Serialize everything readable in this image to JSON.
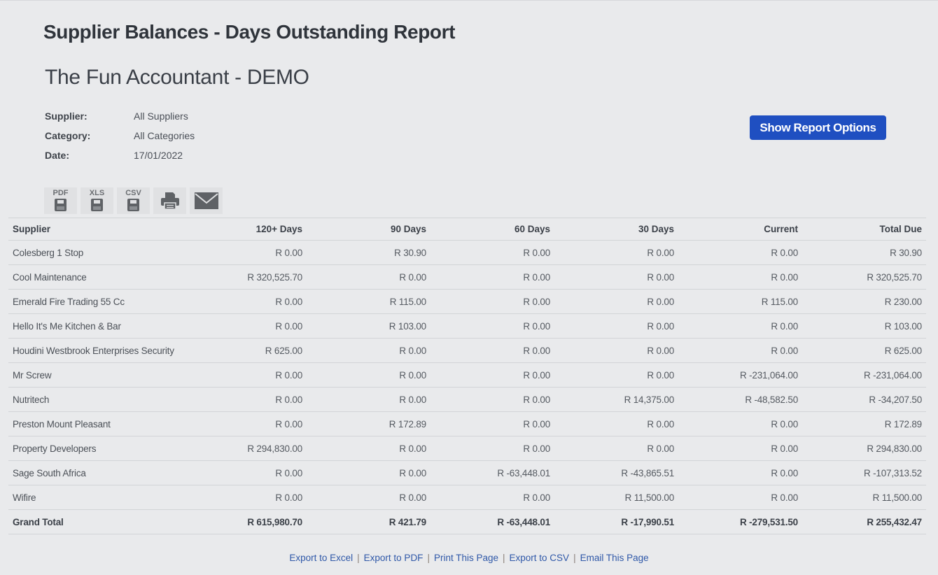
{
  "header": {
    "report_title": "Supplier Balances - Days Outstanding Report",
    "company_name": "The Fun Accountant - DEMO"
  },
  "filters": [
    {
      "label": "Supplier:",
      "value": "All Suppliers"
    },
    {
      "label": "Category:",
      "value": "All Categories"
    },
    {
      "label": "Date:",
      "value": "17/01/2022"
    }
  ],
  "options_button": {
    "label": "Show Report Options",
    "color": "#1f4fc1"
  },
  "export_icons": [
    {
      "name": "pdf-export",
      "label": "PDF",
      "icon": "floppy-disk-icon"
    },
    {
      "name": "xls-export",
      "label": "XLS",
      "icon": "floppy-disk-icon"
    },
    {
      "name": "csv-export",
      "label": "CSV",
      "icon": "floppy-disk-icon"
    },
    {
      "name": "print",
      "label": "",
      "icon": "printer-icon"
    },
    {
      "name": "email",
      "label": "",
      "icon": "envelope-icon"
    }
  ],
  "table": {
    "columns": [
      "Supplier",
      "120+ Days",
      "90 Days",
      "60 Days",
      "30 Days",
      "Current",
      "Total Due"
    ],
    "rows": [
      [
        "Colesberg 1 Stop",
        "R 0.00",
        "R 30.90",
        "R 0.00",
        "R 0.00",
        "R 0.00",
        "R 30.90"
      ],
      [
        "Cool Maintenance",
        "R 320,525.70",
        "R 0.00",
        "R 0.00",
        "R 0.00",
        "R 0.00",
        "R 320,525.70"
      ],
      [
        "Emerald Fire Trading 55 Cc",
        "R 0.00",
        "R 115.00",
        "R 0.00",
        "R 0.00",
        "R 115.00",
        "R 230.00"
      ],
      [
        "Hello It's Me Kitchen & Bar",
        "R 0.00",
        "R 103.00",
        "R 0.00",
        "R 0.00",
        "R 0.00",
        "R 103.00"
      ],
      [
        "Houdini Westbrook Enterprises Security",
        "R 625.00",
        "R 0.00",
        "R 0.00",
        "R 0.00",
        "R 0.00",
        "R 625.00"
      ],
      [
        "Mr Screw",
        "R 0.00",
        "R 0.00",
        "R 0.00",
        "R 0.00",
        "R -231,064.00",
        "R -231,064.00"
      ],
      [
        "Nutritech",
        "R 0.00",
        "R 0.00",
        "R 0.00",
        "R 14,375.00",
        "R -48,582.50",
        "R -34,207.50"
      ],
      [
        "Preston Mount Pleasant",
        "R 0.00",
        "R 172.89",
        "R 0.00",
        "R 0.00",
        "R 0.00",
        "R 172.89"
      ],
      [
        "Property Developers",
        "R 294,830.00",
        "R 0.00",
        "R 0.00",
        "R 0.00",
        "R 0.00",
        "R 294,830.00"
      ],
      [
        "Sage South Africa",
        "R 0.00",
        "R 0.00",
        "R -63,448.01",
        "R -43,865.51",
        "R 0.00",
        "R -107,313.52"
      ],
      [
        "Wifire",
        "R 0.00",
        "R 0.00",
        "R 0.00",
        "R 11,500.00",
        "R 0.00",
        "R 11,500.00"
      ]
    ],
    "total": [
      "Grand Total",
      "R 615,980.70",
      "R 421.79",
      "R -63,448.01",
      "R -17,990.51",
      "R -279,531.50",
      "R 255,432.47"
    ]
  },
  "footer_links": [
    "Export to Excel",
    "Export to PDF",
    "Print This Page",
    "Export to CSV",
    "Email This Page"
  ],
  "footer_separator": "|",
  "colors": {
    "background": "#e9eaec",
    "link": "#2f58a8",
    "button": "#1f4fc1"
  }
}
